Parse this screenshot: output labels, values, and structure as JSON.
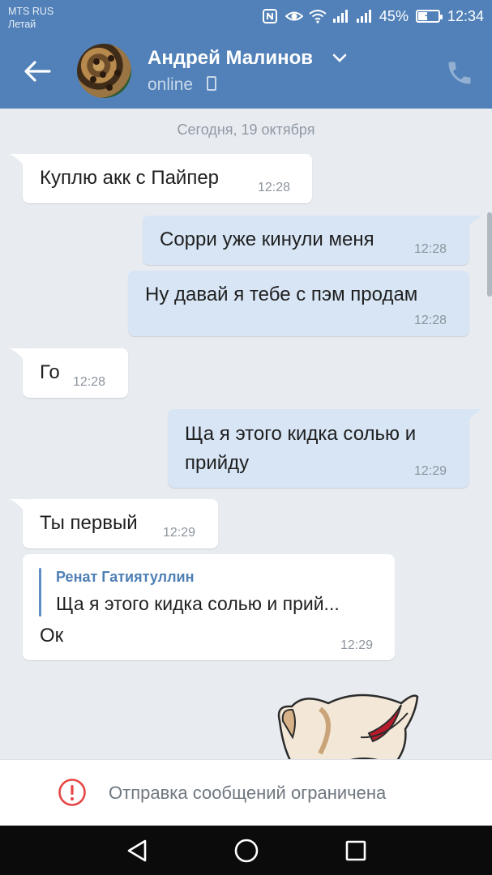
{
  "status_bar": {
    "carrier_line1": "MTS RUS",
    "carrier_line2": "Летай",
    "battery_percent": "45%",
    "battery_level": 0.45,
    "time": "12:34",
    "icons": [
      "nfc-icon",
      "eye-icon",
      "wifi-icon",
      "signal-icon",
      "signal-icon",
      "battery-icon"
    ]
  },
  "header": {
    "contact_name": "Андрей Малинов",
    "status": "online",
    "icons": [
      "back-arrow-icon",
      "chevron-down-icon",
      "mobile-icon",
      "phone-icon"
    ],
    "accent_color": "#5181b8"
  },
  "chat": {
    "date_separator": "Сегодня, 19 октября",
    "messages": [
      {
        "direction": "in",
        "text": "Куплю акк с Пайпер",
        "time": "12:28"
      },
      {
        "direction": "out",
        "text": "Сорри уже кинули меня",
        "time": "12:28"
      },
      {
        "direction": "out",
        "text": "Ну давай я тебе с пэм продам",
        "time": "12:28"
      },
      {
        "direction": "in",
        "text": "Го",
        "time": "12:28"
      },
      {
        "direction": "out",
        "text_line1": "Ща я этого кидка солью и",
        "text_line2": "прийду",
        "time": "12:29"
      },
      {
        "direction": "in",
        "text": "Ты первый",
        "time": "12:29"
      },
      {
        "direction": "in",
        "reply_author": "Ренат Гатиятуллин",
        "reply_text": "Ща я этого кидка солью и прий...",
        "text": "Ок",
        "time": "12:29"
      }
    ],
    "bubble_colors": {
      "incoming": "#ffffff",
      "outgoing": "#d7e5f5"
    }
  },
  "restriction": {
    "text": "Отправка сообщений ограничена",
    "icon": "alert-circle-icon",
    "icon_color": "#e64646"
  },
  "nav_bar": {
    "icons": [
      "back-triangle-icon",
      "home-circle-icon",
      "recents-square-icon"
    ]
  }
}
